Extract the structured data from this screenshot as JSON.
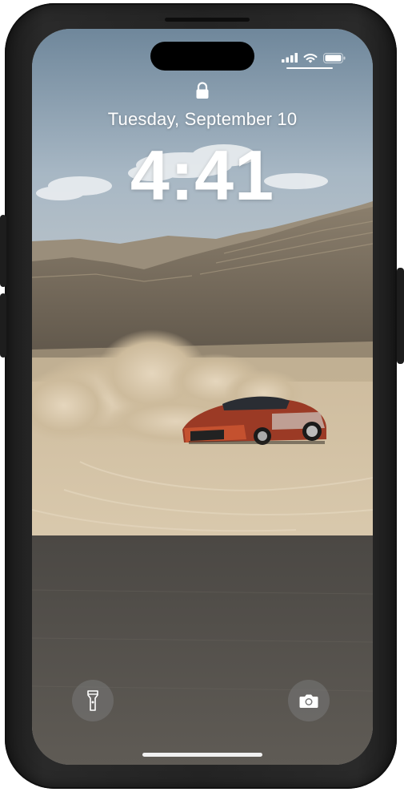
{
  "lock_screen": {
    "date": "Tuesday, September 10",
    "time": "4:41"
  },
  "icons": {
    "status": [
      "cellular-signal-icon",
      "wifi-icon",
      "battery-icon"
    ],
    "lock": "lock-icon",
    "quick_actions": [
      "flashlight-icon",
      "camera-icon"
    ]
  },
  "colors": {
    "case": "#242424",
    "sky": "#8fa3b4",
    "desert": "#c9b89c",
    "car": "#b5452d",
    "text": "#ffffff"
  }
}
